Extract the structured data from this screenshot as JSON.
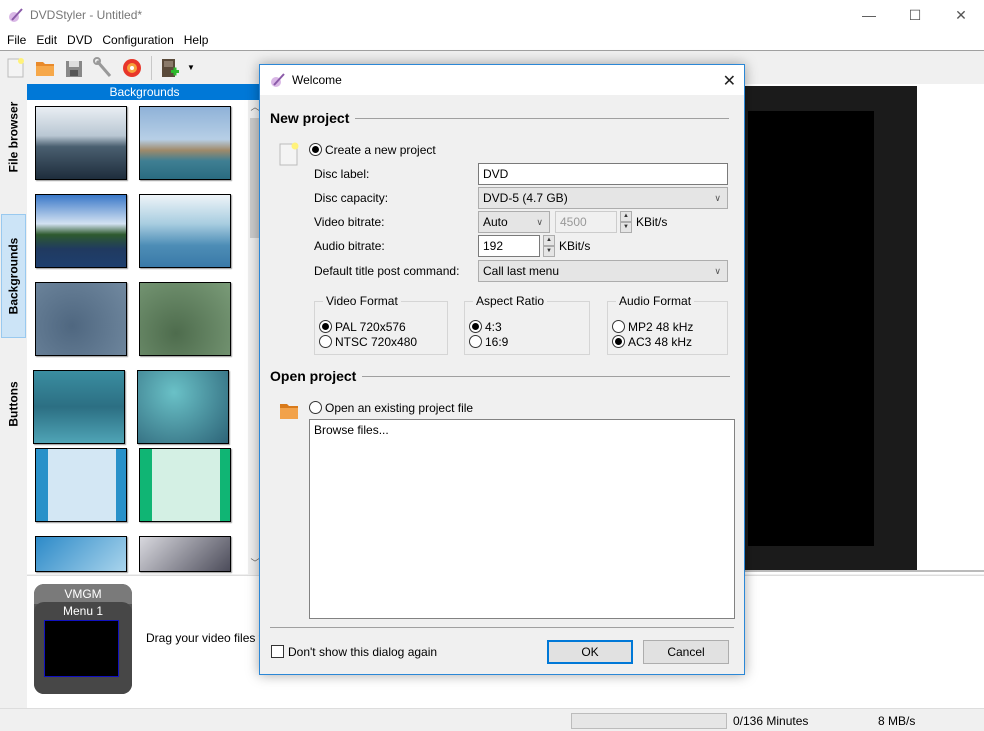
{
  "window": {
    "title": "DVDStyler - Untitled*",
    "controls": {
      "minimize": "—",
      "maximize": "☐",
      "close": "✕"
    }
  },
  "menubar": {
    "items": [
      "File",
      "Edit",
      "DVD",
      "Configuration",
      "Help"
    ]
  },
  "toolbar": {
    "buttons": [
      "new-project",
      "open-project",
      "save-project",
      "settings",
      "burn-dvd",
      "add-file"
    ]
  },
  "sidebar": {
    "tabs": [
      {
        "label": "File browser",
        "active": false
      },
      {
        "label": "Backgrounds",
        "active": true
      },
      {
        "label": "Buttons",
        "active": false
      }
    ],
    "panel_title": "Backgrounds"
  },
  "titleset": {
    "vmgm_label": "VMGM",
    "menu_label": "Menu 1",
    "drag_hint": "Drag your video files f"
  },
  "statusbar": {
    "progress_fraction": 0,
    "minutes": "0/136 Minutes",
    "rate": "8 MB/s"
  },
  "dialog": {
    "title": "Welcome",
    "close": "✕",
    "new_project": {
      "heading": "New project",
      "create_label": "Create a new project",
      "create_selected": true,
      "disc_label": {
        "label": "Disc label:",
        "value": "DVD"
      },
      "disc_capacity": {
        "label": "Disc capacity:",
        "value": "DVD-5 (4.7 GB)"
      },
      "video_bitrate": {
        "label": "Video bitrate:",
        "mode": "Auto",
        "value": "4500",
        "unit": "KBit/s"
      },
      "audio_bitrate": {
        "label": "Audio bitrate:",
        "value": "192",
        "unit": "KBit/s"
      },
      "post_command": {
        "label": "Default title post command:",
        "value": "Call last menu"
      },
      "video_format": {
        "label": "Video Format",
        "options": [
          {
            "label": "PAL 720x576",
            "selected": true
          },
          {
            "label": "NTSC 720x480",
            "selected": false
          }
        ]
      },
      "aspect_ratio": {
        "label": "Aspect Ratio",
        "options": [
          {
            "label": "4:3",
            "selected": true
          },
          {
            "label": "16:9",
            "selected": false
          }
        ]
      },
      "audio_format": {
        "label": "Audio Format",
        "options": [
          {
            "label": "MP2 48 kHz",
            "selected": false
          },
          {
            "label": "AC3 48 kHz",
            "selected": true
          }
        ]
      }
    },
    "open_project": {
      "heading": "Open project",
      "open_label": "Open an existing project file",
      "open_selected": false,
      "files": [
        "Browse files..."
      ]
    },
    "dont_show": {
      "label": "Don't show this dialog again",
      "checked": false
    },
    "ok_label": "OK",
    "cancel_label": "Cancel"
  }
}
